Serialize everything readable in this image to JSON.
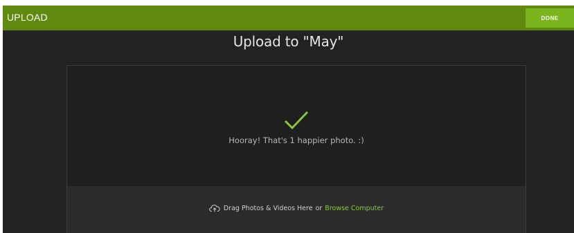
{
  "header": {
    "title": "UPLOAD",
    "done_label": "DONE"
  },
  "upload": {
    "title": "Upload to \"May\"",
    "success_message": "Hooray! That's 1 happier photo. :)",
    "check_icon": "checkmark-icon"
  },
  "dropzone": {
    "icon": "cloud-upload-icon",
    "drag_text": "Drag Photos & Videos Here",
    "or_text": "or",
    "browse_label": "Browse Computer"
  },
  "colors": {
    "header_bg": "#5f8a0e",
    "button_bg": "#7ab51d",
    "accent": "#8cc63f",
    "background": "#222222"
  }
}
